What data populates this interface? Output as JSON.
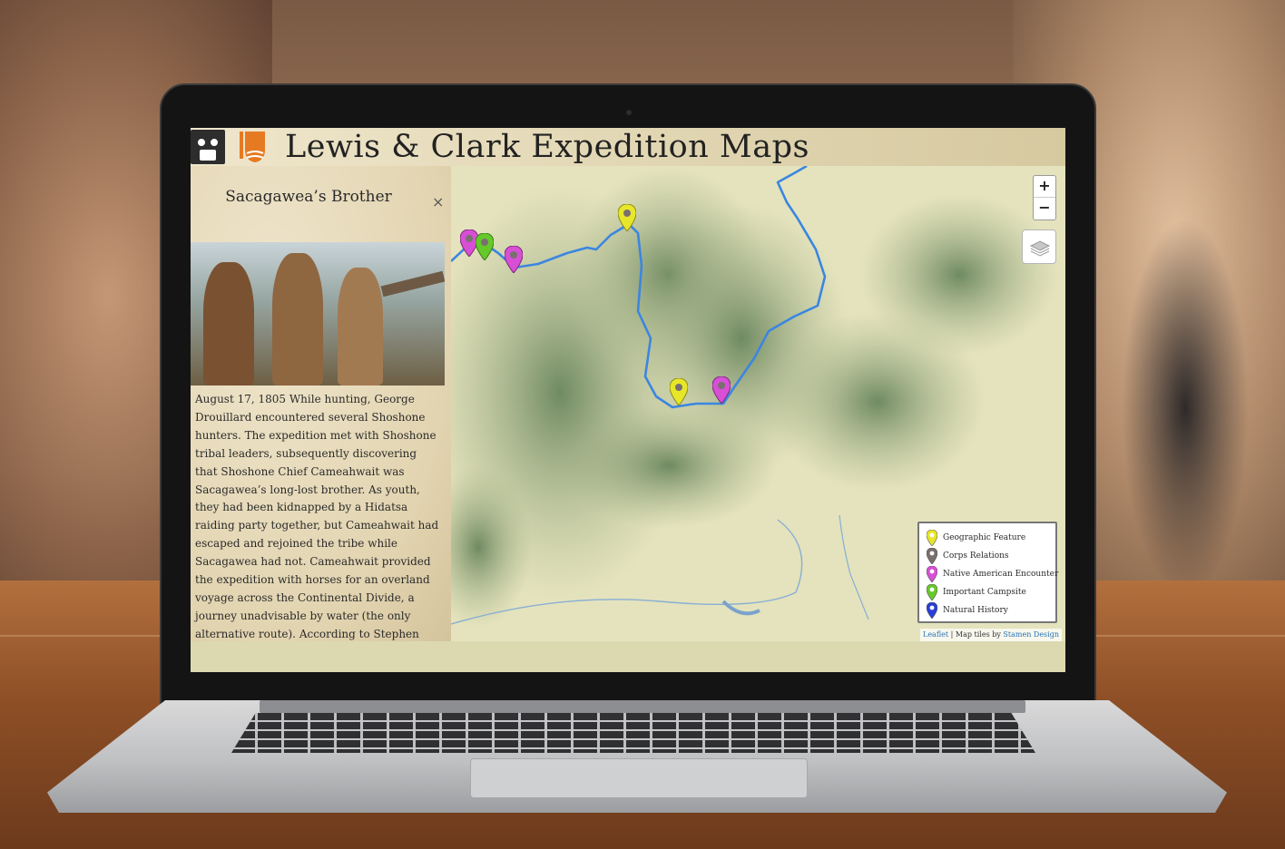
{
  "app": {
    "title": "Lewis & Clark Expedition Maps"
  },
  "sidebar": {
    "title": "Sacagawea’s Brother",
    "close_label": "×",
    "body": "August 17, 1805 While hunting, George Drouillard encountered several Shoshone hunters. The expedition met with Shoshone tribal leaders, subsequently discovering that Shoshone Chief Cameahwait was Sacagawea’s long-lost brother. As youth, they had been kidnapped by a Hidatsa raiding party together, but Cameahwait had escaped and rejoined the tribe while Sacagawea had not. Cameahwait provided the expedition with horses for an overland voyage across the Continental Divide, a journey unadvisable by water (the only alternative route). According to Stephen Ambrose’s article \"Immense Mountains to the"
  },
  "map": {
    "zoom_in": "+",
    "zoom_out": "−",
    "legend": [
      {
        "label": "Geographic Feature",
        "color": "#e8e62a"
      },
      {
        "label": "Corps Relations",
        "color": "#7a6f6f"
      },
      {
        "label": "Native American Encounter",
        "color": "#d84fd6"
      },
      {
        "label": "Important Campsite",
        "color": "#66c92a"
      },
      {
        "label": "Natural History",
        "color": "#2a3fd6"
      }
    ],
    "attribution": {
      "leaflet": "Leaflet",
      "separator": " | Map tiles by ",
      "provider": "Stamen Design"
    },
    "route_color": "#3b86e0"
  }
}
